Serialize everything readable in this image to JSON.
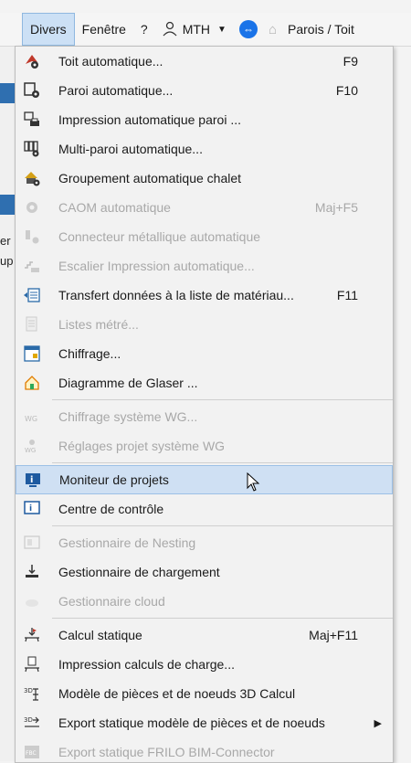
{
  "menubar": {
    "divers": "Divers",
    "fenetre": "Fenêtre",
    "help": "?",
    "user": "MTH",
    "right_text": "Parois / Toit"
  },
  "leftstrip": {
    "t1": "er",
    "t2": "up"
  },
  "menu": {
    "items": [
      {
        "label": "Toit automatique...",
        "shortcut": "F9",
        "enabled": true
      },
      {
        "label": "Paroi automatique...",
        "shortcut": "F10",
        "enabled": true
      },
      {
        "label": "Impression automatique paroi ...",
        "shortcut": "",
        "enabled": true
      },
      {
        "label": "Multi-paroi automatique...",
        "shortcut": "",
        "enabled": true
      },
      {
        "label": "Groupement automatique chalet",
        "shortcut": "",
        "enabled": true
      },
      {
        "label": "CAOM automatique",
        "shortcut": "Maj+F5",
        "enabled": false
      },
      {
        "label": "Connecteur métallique automatique",
        "shortcut": "",
        "enabled": false
      },
      {
        "label": "Escalier Impression automatique...",
        "shortcut": "",
        "enabled": false
      },
      {
        "label": "Transfert données à la liste de matériau...",
        "shortcut": "F11",
        "enabled": true
      },
      {
        "label": "Listes métré...",
        "shortcut": "",
        "enabled": false
      },
      {
        "label": "Chiffrage...",
        "shortcut": "",
        "enabled": true
      },
      {
        "label": "Diagramme de Glaser ...",
        "shortcut": "",
        "enabled": true
      },
      {
        "label": "Chiffrage système WG...",
        "shortcut": "",
        "enabled": false
      },
      {
        "label": "Réglages projet système WG",
        "shortcut": "",
        "enabled": false
      },
      {
        "label": "Moniteur de projets",
        "shortcut": "",
        "enabled": true
      },
      {
        "label": "Centre de contrôle",
        "shortcut": "",
        "enabled": true
      },
      {
        "label": "Gestionnaire de Nesting",
        "shortcut": "",
        "enabled": false
      },
      {
        "label": "Gestionnaire de chargement",
        "shortcut": "",
        "enabled": true
      },
      {
        "label": "Gestionnaire cloud",
        "shortcut": "",
        "enabled": false
      },
      {
        "label": "Calcul statique",
        "shortcut": "Maj+F11",
        "enabled": true
      },
      {
        "label": "Impression calculs de charge...",
        "shortcut": "",
        "enabled": true
      },
      {
        "label": "Modèle de pièces et de noeuds 3D Calcul",
        "shortcut": "",
        "enabled": true
      },
      {
        "label": "Export statique modèle de pièces et de noeuds",
        "shortcut": "",
        "enabled": true
      },
      {
        "label": "Export statique FRILO BIM-Connector",
        "shortcut": "",
        "enabled": false
      }
    ]
  },
  "colors": {
    "hover_bg": "#cfe0f3",
    "active_menu_bg": "#cce0f5",
    "disabled_text": "#a8a8a8"
  }
}
